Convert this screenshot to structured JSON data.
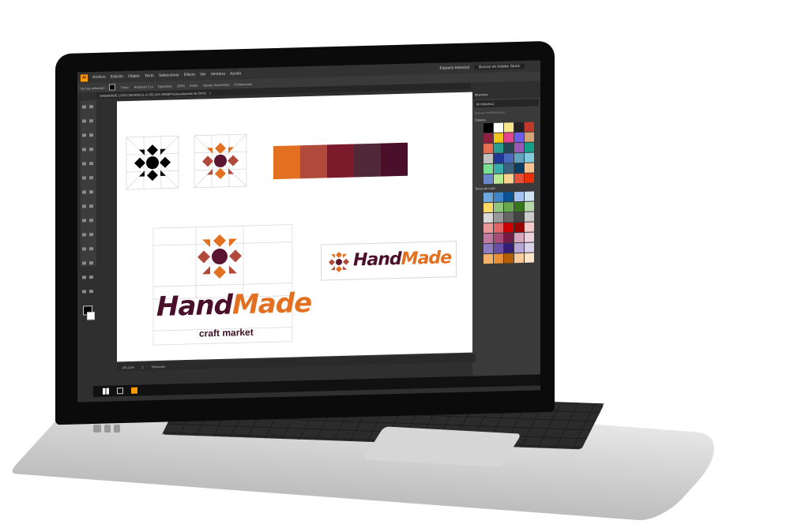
{
  "menubar": {
    "app_icon": "Ai",
    "items": [
      "Archivo",
      "Edición",
      "Objeto",
      "Texto",
      "Seleccionar",
      "Efecto",
      "Ver",
      "Ventana",
      "Ayuda"
    ],
    "workspace": "Espacio esencial",
    "search_placeholder": "Buscar en Adobe Stock"
  },
  "controlbar": {
    "selection": "No hay selección",
    "stroke_label": "Trazo:",
    "style_label": "Redondo 5 pt",
    "opacity_label": "Opacidad:",
    "opacity_value": "100%",
    "style": "Estilo:",
    "doc_setup": "Ajustar documento",
    "prefs": "Preferencias"
  },
  "document_tab": {
    "title": "HANDMADE LOGO DESIGN.ai al 135,11% (RGB/Previsualización de GPU)",
    "close": "×"
  },
  "canvas": {
    "palette": [
      "#e27020",
      "#b04a3a",
      "#7a1a2a",
      "#512838",
      "#4a0f2a"
    ],
    "logo_colors": {
      "orange": "#e27020",
      "brick": "#b04a3a",
      "plum": "#5a1530",
      "dark": "#3a0e22"
    },
    "brand_word1": "Hand",
    "brand_word2": "Made",
    "tagline": "craft market",
    "small_brand_word1": "Hand",
    "small_brand_word2": "Made"
  },
  "statusbar": {
    "zoom": "135,11%",
    "artboard": "1",
    "tool": "Selección"
  },
  "panel": {
    "title": "Muestras",
    "library": "Mi biblioteca",
    "search_placeholder": "Buscar en bibliotecas",
    "section1": "Colores",
    "section2": "Tonos de color",
    "swatches_top": [
      "#000000",
      "#ffffff",
      "#f6e58d",
      "#222222",
      "#c0392b",
      "#8e1f3f",
      "#f0c419",
      "#e84393",
      "#6c5ce7",
      "#d4a373",
      "#e76f51",
      "#2a9d8f",
      "#264653",
      "#9b59b6",
      "#16a085",
      "#c0c0c0",
      "#1e3799",
      "#4a69bd",
      "#60a3bc",
      "#82ccdd",
      "#78e08f",
      "#38ada9",
      "#3c6382",
      "#0a3d62",
      "#f8c291",
      "#6a89cc",
      "#b8e994",
      "#fad390",
      "#e55039",
      "#eb2f06"
    ],
    "swatches_bottom": [
      "#6fa8dc",
      "#3d85c6",
      "#0b5394",
      "#a4c2f4",
      "#cfe2f3",
      "#ffd966",
      "#93c47d",
      "#6aa84f",
      "#38761d",
      "#b6d7a8",
      "#d9d9d9",
      "#999999",
      "#666666",
      "#434343",
      "#cccccc",
      "#ea9999",
      "#e06666",
      "#cc0000",
      "#990000",
      "#f4cccc",
      "#c27ba0",
      "#a64d79",
      "#741b47",
      "#d5a6bd",
      "#ead1dc",
      "#8e7cc3",
      "#674ea7",
      "#351c75",
      "#b4a7d6",
      "#d9d2e9",
      "#f6b26b",
      "#e69138",
      "#b45f06",
      "#f9cb9c",
      "#fce5cd"
    ]
  },
  "taskbar": {
    "icons": [
      "windows-icon",
      "task-view-icon",
      "illustrator-icon"
    ]
  }
}
